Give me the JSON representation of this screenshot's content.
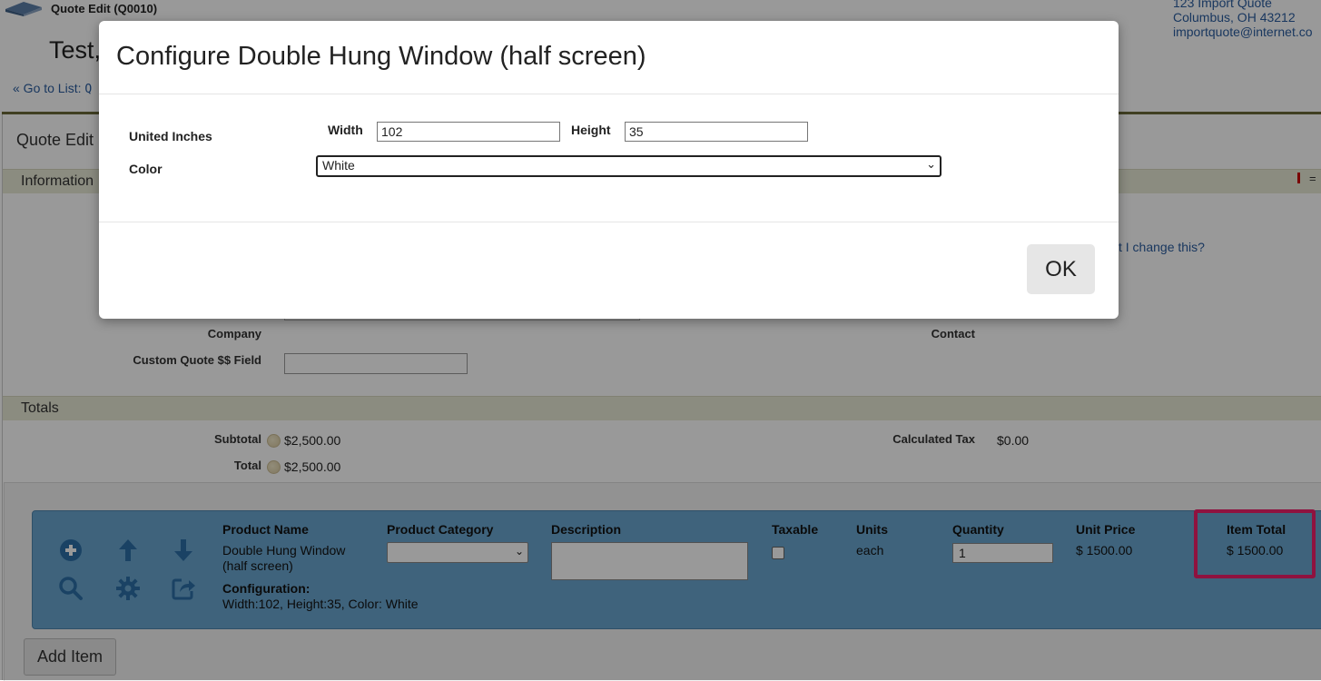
{
  "header": {
    "breadcrumb_label": "Quote Edit (Q0010)",
    "page_title": "Test,",
    "go_to_list_prefix": "« Go to List: ",
    "go_to_list_link": "Q",
    "address": [
      "123 Import Quote",
      "Columbus, OH 43212",
      "importquote@internet.co"
    ]
  },
  "main": {
    "heading": "Quote Edit",
    "info_section": "Information",
    "change_link": "t I change this?",
    "fields": {
      "company_label": "Company",
      "contact_label": "Contact",
      "custom_field_label": "Custom Quote $$ Field",
      "custom_field_value": ""
    },
    "totals_section": "Totals",
    "totals": {
      "subtotal_label": "Subtotal",
      "subtotal_value": "$2,500.00",
      "total_label": "Total",
      "total_value": "$2,500.00",
      "calc_tax_label": "Calculated Tax",
      "calc_tax_value": "$0.00"
    }
  },
  "line_item": {
    "icons": [
      "add-circle-icon",
      "arrow-up-icon",
      "arrow-down-icon",
      "search-icon",
      "gear-icon",
      "share-icon"
    ],
    "headers": {
      "product_name": "Product Name",
      "product_category": "Product Category",
      "description": "Description",
      "taxable": "Taxable",
      "units": "Units",
      "quantity": "Quantity",
      "unit_price": "Unit Price",
      "item_total": "Item Total"
    },
    "product_name_line1": "Double Hung Window",
    "product_name_line2": "(half screen)",
    "configuration_label": "Configuration:",
    "configuration_value": "Width:102, Height:35, Color: White",
    "product_category_value": "",
    "description_value": "",
    "taxable_checked": false,
    "units_value": "each",
    "quantity_value": "1",
    "unit_price_value": "$ 1500.00",
    "item_total_value": "$ 1500.00",
    "highlight_color": "#ee1f6a",
    "row_color": "#6aa6cf"
  },
  "add_item_button": "Add Item",
  "modal": {
    "title": "Configure Double Hung Window (half screen)",
    "united_inches_label": "United Inches",
    "width_label": "Width",
    "width_value": "102",
    "height_label": "Height",
    "height_value": "35",
    "color_label": "Color",
    "color_value": "White",
    "ok_label": "OK"
  }
}
